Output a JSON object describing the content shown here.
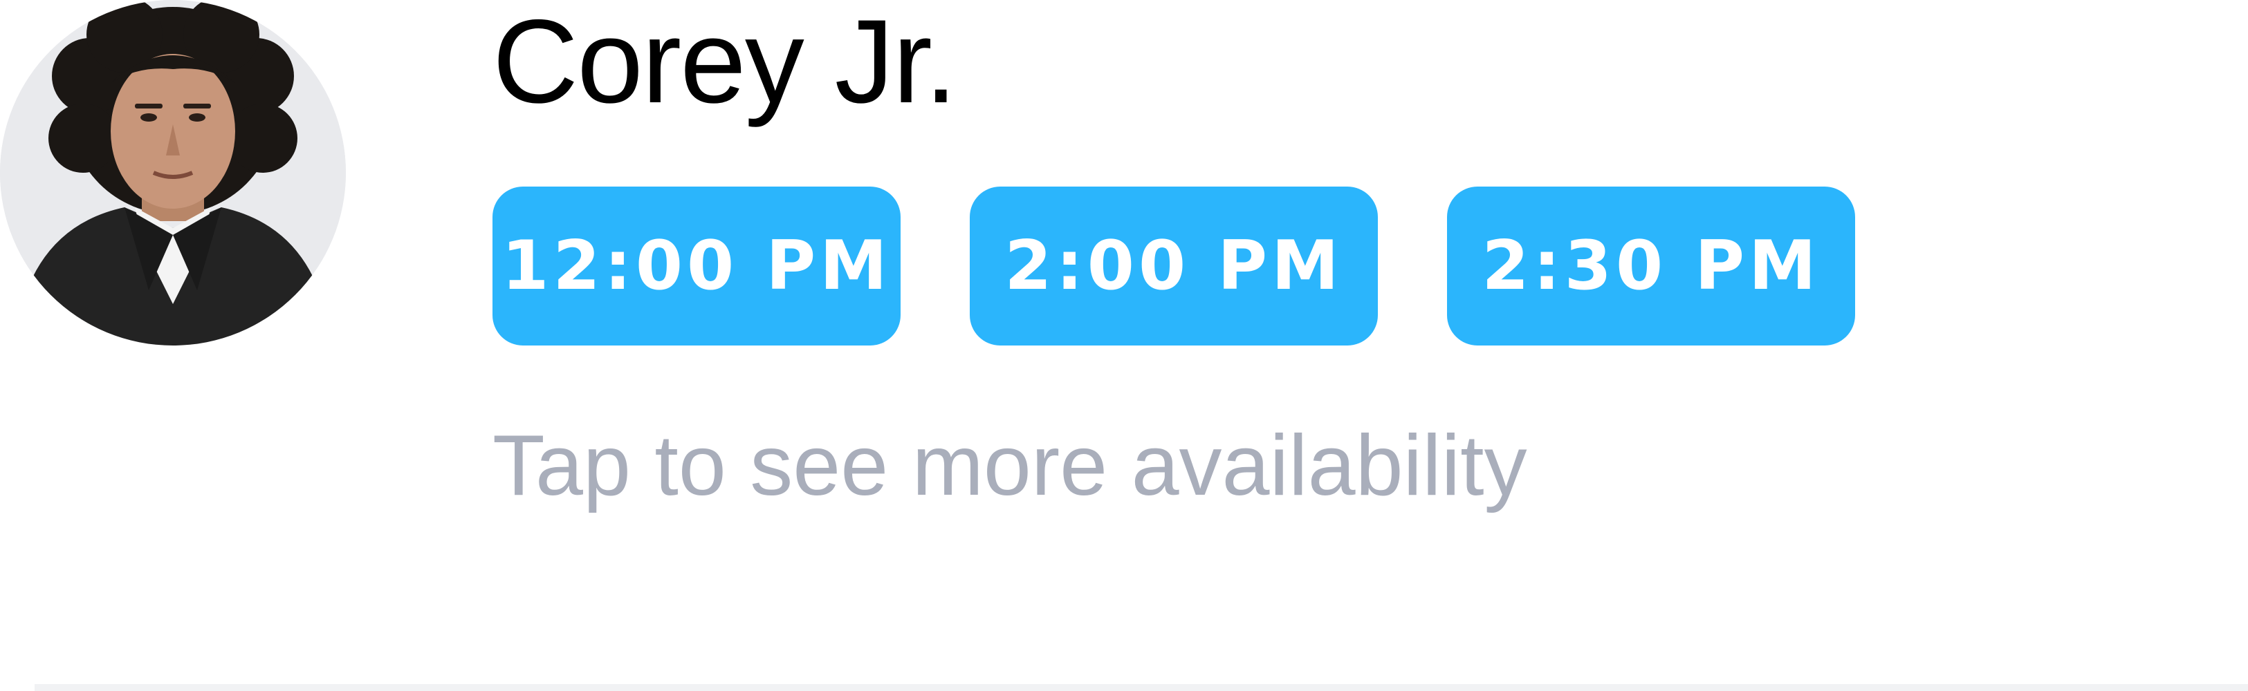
{
  "provider": {
    "name": "Corey Jr.",
    "avatar_icon": "person-photo-icon"
  },
  "availability": {
    "slots": [
      {
        "label": "12:00 PM"
      },
      {
        "label": "2:00 PM"
      },
      {
        "label": "2:30 PM"
      }
    ],
    "more_link": "Tap to see more availability"
  },
  "colors": {
    "slot_background": "#2bb5fc",
    "slot_text": "#ffffff",
    "name_text": "#000000",
    "hint_text": "#a9aebb",
    "divider": "#f1f2f4"
  }
}
